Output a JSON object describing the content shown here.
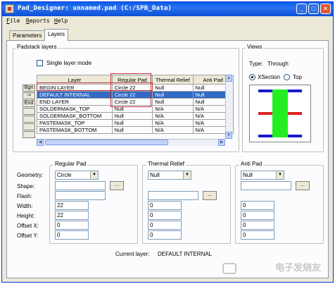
{
  "window": {
    "title": "Pad_Designer: unnamed.pad (C:/SPB_Data)"
  },
  "menu": [
    "File",
    "Reports",
    "Help"
  ],
  "tabs": [
    {
      "label": "Parameters",
      "active": false
    },
    {
      "label": "Layers",
      "active": true
    }
  ],
  "padstack": {
    "group_label": "Padstack layers",
    "single_layer_label": "Single layer mode",
    "single_layer_checked": false,
    "columns": [
      "Layer",
      "Regular Pad",
      "Thermal Relief",
      "Anti Pad"
    ],
    "row_buttons": [
      "Bgn",
      "->",
      "End",
      "",
      "",
      "",
      ""
    ],
    "rows": [
      [
        "BEGIN LAYER",
        "Circle 22",
        "Null",
        "Null"
      ],
      [
        "DEFAULT INTERNAL",
        "Circle 22",
        "Null",
        "Null"
      ],
      [
        "END LAYER",
        "Circle 22",
        "Null",
        "Null"
      ],
      [
        "SOLDERMASK_TOP",
        "Null",
        "N/A",
        "N/A"
      ],
      [
        "SOLDERMASK_BOTTOM",
        "Null",
        "N/A",
        "N/A"
      ],
      [
        "PASTEMASK_TOP",
        "Null",
        "N/A",
        "N/A"
      ],
      [
        "PASTEMASK_BOTTOM",
        "Null",
        "N/A",
        "N/A"
      ]
    ],
    "selected_row": 1
  },
  "views": {
    "group_label": "Views",
    "type_label": "Type:",
    "type_value": "Through",
    "xsection_label": "XSection",
    "top_label": "Top",
    "selected": "XSection",
    "colors": {
      "pad": "#1a1acc",
      "drill": "#22ee22",
      "plane": "#dd2222"
    }
  },
  "editor": {
    "row_labels": [
      "Geometry:",
      "Shape:",
      "Flash:",
      "Width:",
      "Height:",
      "Offset X:",
      "Offset Y:"
    ],
    "regular": {
      "label": "Regular Pad",
      "geometry": "Circle",
      "shape": "",
      "flash": "",
      "width": "22",
      "height": "22",
      "offset_x": "0",
      "offset_y": "0"
    },
    "thermal": {
      "label": "Thermal Relief",
      "geometry": "Null",
      "shape": "",
      "flash": "",
      "width": "0",
      "height": "0",
      "offset_x": "0",
      "offset_y": "0"
    },
    "anti": {
      "label": "Anti Pad",
      "geometry": "Null",
      "shape": "",
      "flash": "",
      "width": "0",
      "height": "0",
      "offset_x": "0",
      "offset_y": "0"
    },
    "ellipsis": "...",
    "current_layer_label": "Current layer:",
    "current_layer_value": "DEFAULT INTERNAL"
  },
  "watermark": "电子发烧友"
}
